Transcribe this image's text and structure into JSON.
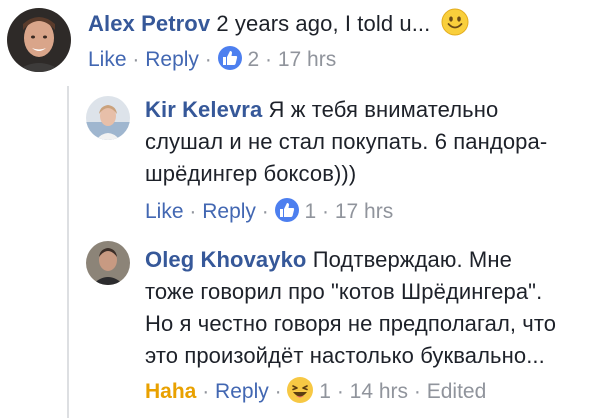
{
  "comments": [
    {
      "author": "Alex Petrov",
      "text": "2 years ago, I told u...",
      "actions": {
        "like": "Like",
        "reply": "Reply",
        "reaction_count": "2",
        "time": "17 hrs"
      }
    },
    {
      "author": "Kir Kelevra",
      "line1": "Я ж тебя внимательно",
      "line2": "слушал и не стал покупать. 6 пандора-",
      "line3": "шрёдингер боксов)))",
      "actions": {
        "like": "Like",
        "reply": "Reply",
        "reaction_count": "1",
        "time": "17 hrs"
      }
    },
    {
      "author": "Oleg Khovayko",
      "line1": "Подтверждаю. Мне",
      "line2": "тоже говорил про \"котов Шрёдингера\".",
      "line3": "Но я честно говоря не предполагал, что",
      "line4": "это произойдёт настолько буквально...",
      "actions": {
        "like": "Haha",
        "reply": "Reply",
        "reaction_count": "1",
        "time": "14 hrs",
        "edited": "Edited"
      }
    }
  ],
  "separator": "·",
  "colors": {
    "author": "#365899",
    "link": "#4267b2",
    "meta": "#90949c",
    "haha": "#e9a100",
    "like_badge": "#4d7fef"
  },
  "icons": [
    "smiley-emoji-icon",
    "like-reaction-icon",
    "haha-reaction-icon"
  ]
}
